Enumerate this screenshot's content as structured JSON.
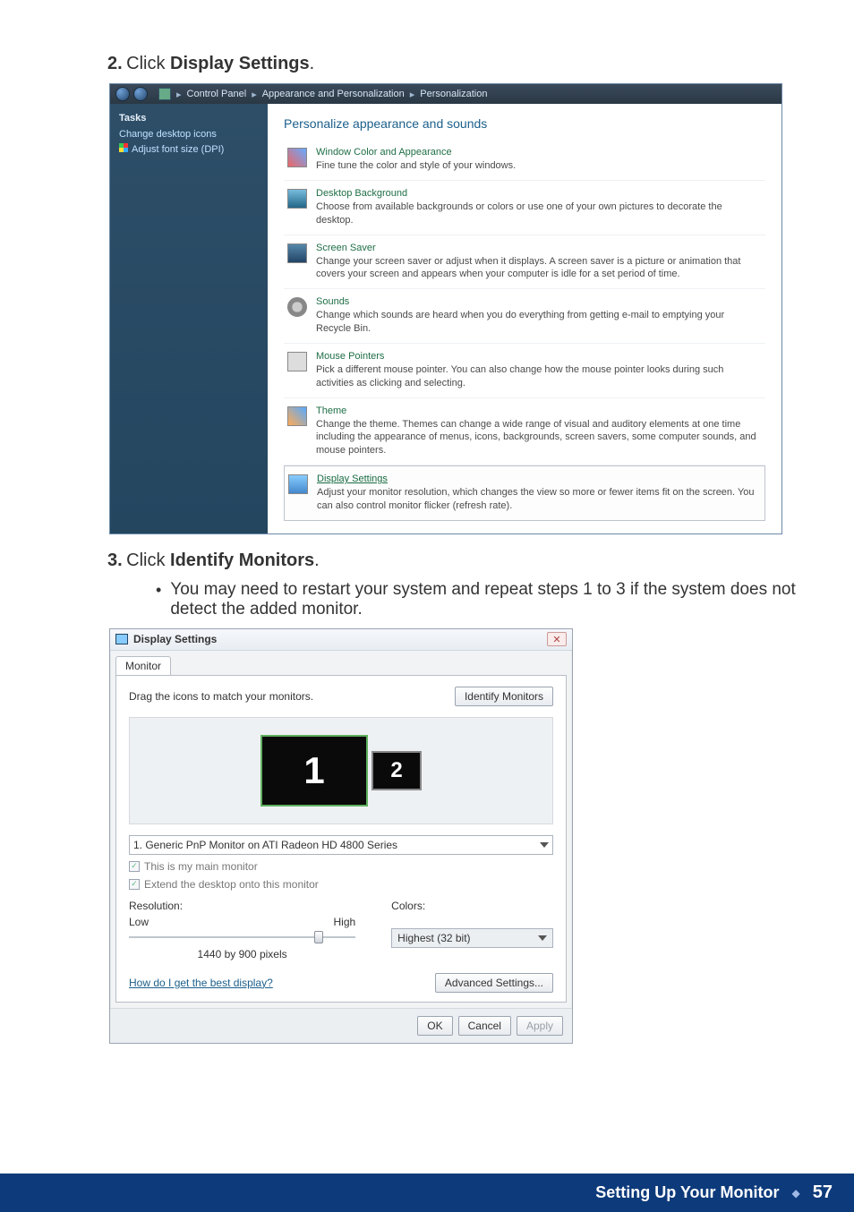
{
  "step2": {
    "num": "2.",
    "prefix": "Click ",
    "bold": "Display Settings",
    "suffix": "."
  },
  "cp": {
    "breadcrumb": {
      "a": "Control Panel",
      "b": "Appearance and Personalization",
      "c": "Personalization"
    },
    "sidebar": {
      "tasks": "Tasks",
      "link1": "Change desktop icons",
      "link2": "Adjust font size (DPI)"
    },
    "title": "Personalize appearance and sounds",
    "items": [
      {
        "name": "Window Color and Appearance",
        "desc": "Fine tune the color and style of your windows."
      },
      {
        "name": "Desktop Background",
        "desc": "Choose from available backgrounds or colors or use one of your own pictures to decorate the desktop."
      },
      {
        "name": "Screen Saver",
        "desc": "Change your screen saver or adjust when it displays. A screen saver is a picture or animation that covers your screen and appears when your computer is idle for a set period of time."
      },
      {
        "name": "Sounds",
        "desc": "Change which sounds are heard when you do everything from getting e-mail to emptying your Recycle Bin."
      },
      {
        "name": "Mouse Pointers",
        "desc": "Pick a different mouse pointer. You can also change how the mouse pointer looks during such activities as clicking and selecting."
      },
      {
        "name": "Theme",
        "desc": "Change the theme. Themes can change a wide range of visual and auditory elements at one time including the appearance of menus, icons, backgrounds, screen savers, some computer sounds, and mouse pointers."
      },
      {
        "name": "Display Settings",
        "desc": "Adjust your monitor resolution, which changes the view so more or fewer items fit on the screen. You can also control monitor flicker (refresh rate)."
      }
    ]
  },
  "step3": {
    "num": "3.",
    "prefix": "Click ",
    "bold": "Identify Monitors",
    "suffix": "."
  },
  "bullet": "You may need to restart your system and repeat steps 1 to 3 if the system does not detect the added monitor.",
  "ds": {
    "title": "Display Settings",
    "tab": "Monitor",
    "drag_hint": "Drag the icons to match your monitors.",
    "identify_btn": "Identify Monitors",
    "mon1": "1",
    "mon2": "2",
    "dropdown": "1. Generic PnP Monitor on ATI Radeon HD 4800 Series",
    "chk_main": "This is my main monitor",
    "chk_extend": "Extend the desktop onto this monitor",
    "res_label": "Resolution:",
    "low": "Low",
    "high": "High",
    "res_value": "1440 by 900 pixels",
    "colors_label": "Colors:",
    "colors_value": "Highest (32 bit)",
    "help_link": "How do I get the best display?",
    "adv_btn": "Advanced Settings...",
    "ok": "OK",
    "cancel": "Cancel",
    "apply": "Apply"
  },
  "footer": {
    "title": "Setting Up Your Monitor",
    "page": "57"
  }
}
